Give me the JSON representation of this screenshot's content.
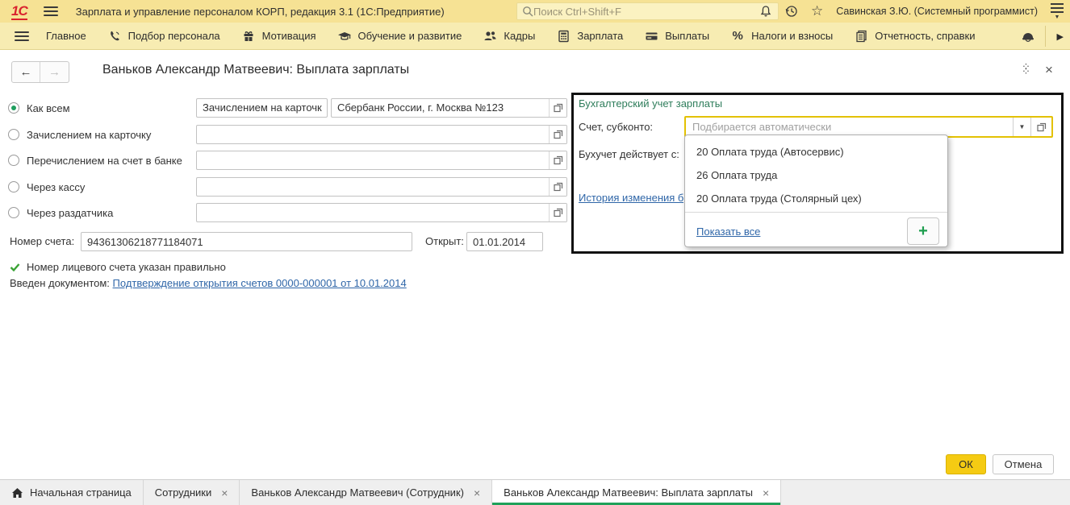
{
  "titlebar": {
    "app_title": "Зарплата и управление персоналом КОРП, редакция 3.1  (1С:Предприятие)",
    "logo": "1С",
    "search_placeholder": "Поиск Ctrl+Shift+F",
    "user": "Савинская З.Ю. (Системный программист)"
  },
  "menubar": {
    "items": [
      {
        "label": "Главное",
        "icon": "hamburger-icon"
      },
      {
        "label": "Подбор персонала",
        "icon": "phone-icon"
      },
      {
        "label": "Мотивация",
        "icon": "gift-icon"
      },
      {
        "label": "Обучение и развитие",
        "icon": "graduation-cap-icon"
      },
      {
        "label": "Кадры",
        "icon": "people-icon"
      },
      {
        "label": "Зарплата",
        "icon": "calculator-icon"
      },
      {
        "label": "Выплаты",
        "icon": "card-icon"
      },
      {
        "label": "Налоги и взносы",
        "icon": "percent-icon"
      },
      {
        "label": "Отчетность, справки",
        "icon": "report-icon"
      }
    ],
    "trailing_icon": "helmet-icon"
  },
  "form": {
    "title": "Ваньков Александр Матвеевич: Выплата зарплаты",
    "payment_methods": [
      {
        "label": "Как всем",
        "selected": true,
        "value1": "Зачислением на карточк",
        "value2": "Сбербанк России, г. Москва №123"
      },
      {
        "label": "Зачислением на карточку",
        "selected": false,
        "value": ""
      },
      {
        "label": "Перечислением на счет в банке",
        "selected": false,
        "value": ""
      },
      {
        "label": "Через кассу",
        "selected": false,
        "value": ""
      },
      {
        "label": "Через раздатчика",
        "selected": false,
        "value": ""
      }
    ],
    "account_number_label": "Номер счета:",
    "account_number": "94361306218771184071",
    "opened_label": "Открыт:",
    "opened_date": "01.01.2014",
    "validation_message": "Номер лицевого счета указан правильно",
    "entered_by_label": "Введен документом:",
    "entered_by_link": "Подтверждение открытия счетов 0000-000001 от 10.01.2014"
  },
  "accounting_panel": {
    "title": "Бухгалтерский учет зарплаты",
    "account_label": "Счет, субконто:",
    "account_placeholder": "Подбирается автоматически",
    "effective_label": "Бухучет действует с:",
    "history_link": "История изменения б",
    "dropdown": {
      "options": [
        "20 Оплата труда (Автосервис)",
        "26 Оплата труда",
        "20 Оплата труда (Столярный цех)"
      ],
      "show_all_label": "Показать все"
    }
  },
  "footer": {
    "ok_label": "ОК",
    "cancel_label": "Отмена"
  },
  "taskbar": {
    "tabs": [
      {
        "label": "Начальная страница",
        "closable": false,
        "active": false,
        "icon": "home-icon"
      },
      {
        "label": "Сотрудники",
        "closable": true,
        "active": false
      },
      {
        "label": "Ваньков Александр Матвеевич (Сотрудник)",
        "closable": true,
        "active": false
      },
      {
        "label": "Ваньков Александр Матвеевич: Выплата зарплаты",
        "closable": true,
        "active": true
      }
    ]
  },
  "glyphs": {
    "close": "×",
    "plus": "+",
    "back_arrow": "←",
    "forward_arrow": "→",
    "percent": "%",
    "dropdown_arrow": "▼",
    "expand_arrow": "▶",
    "star": "☆"
  },
  "colors": {
    "titlebar_bg": "#F6E294",
    "menubar_bg": "#F7ECB2",
    "accent_green": "#1FA15A",
    "active_field_border": "#E3C103",
    "ok_button_bg": "#F5CB13",
    "link_blue": "#2F66A8",
    "logo_red": "#D9232E",
    "panel_border": "#111111"
  }
}
